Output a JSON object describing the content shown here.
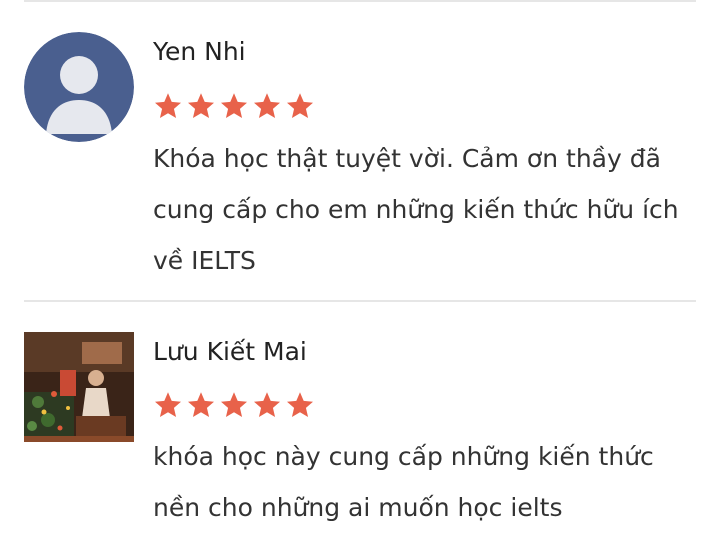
{
  "reviews": [
    {
      "name": "Yen Nhi",
      "rating": 5,
      "comment": "Khóa học thật tuyệt vời. Cảm ơn thầy đã cung cấp cho em những kiến thức hữu ích về IELTS",
      "avatar_icon": "default-user-silhouette-icon"
    },
    {
      "name": "Lưu Kiết Mai",
      "rating": 5,
      "comment": "khóa học này cung cấp những kiến thức nền cho những ai muốn học ielts",
      "avatar_icon": "user-photo"
    }
  ],
  "colors": {
    "star": "#e8624a",
    "avatar_bg": "#4a5f8f",
    "avatar_silhouette": "#e6e8ee",
    "divider": "#e6e6e6",
    "name_text": "#222222",
    "comment_text": "#333333"
  }
}
